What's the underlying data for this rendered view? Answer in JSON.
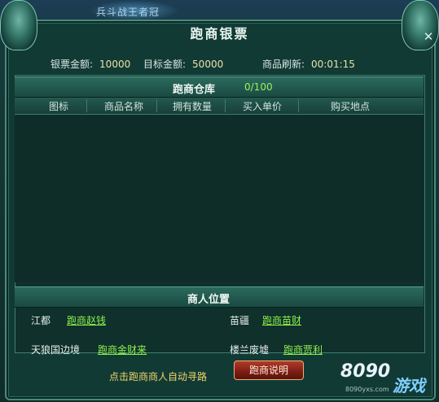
{
  "scene": {
    "banner_text": "兵斗战王者冠"
  },
  "window": {
    "title": "跑商银票",
    "close_symbol": "✕"
  },
  "info": {
    "ticket_amount_label": "银票金额:",
    "ticket_amount": "10000",
    "target_amount_label": "目标金额:",
    "target_amount": "50000",
    "refresh_label": "商品刷新:",
    "refresh_time": "00:01:15"
  },
  "warehouse": {
    "title": "跑商仓库",
    "count": "0/100",
    "columns": [
      "图标",
      "商品名称",
      "拥有数量",
      "买入单价",
      "购买地点"
    ]
  },
  "merchants": {
    "title": "商人位置",
    "entries": [
      {
        "place": "江都",
        "npc": "跑商赵钱"
      },
      {
        "place": "苗疆",
        "npc": "跑商苗财"
      },
      {
        "place": "天狼国边境",
        "npc": "跑商金财来"
      },
      {
        "place": "楼兰废墟",
        "npc": "跑商贾利"
      }
    ]
  },
  "footer": {
    "hint": "点击跑商商人自动寻路",
    "help_button": "跑商说明"
  },
  "watermark": {
    "number": "8090",
    "chinese": "游戏",
    "url": "8090yxs.com"
  }
}
